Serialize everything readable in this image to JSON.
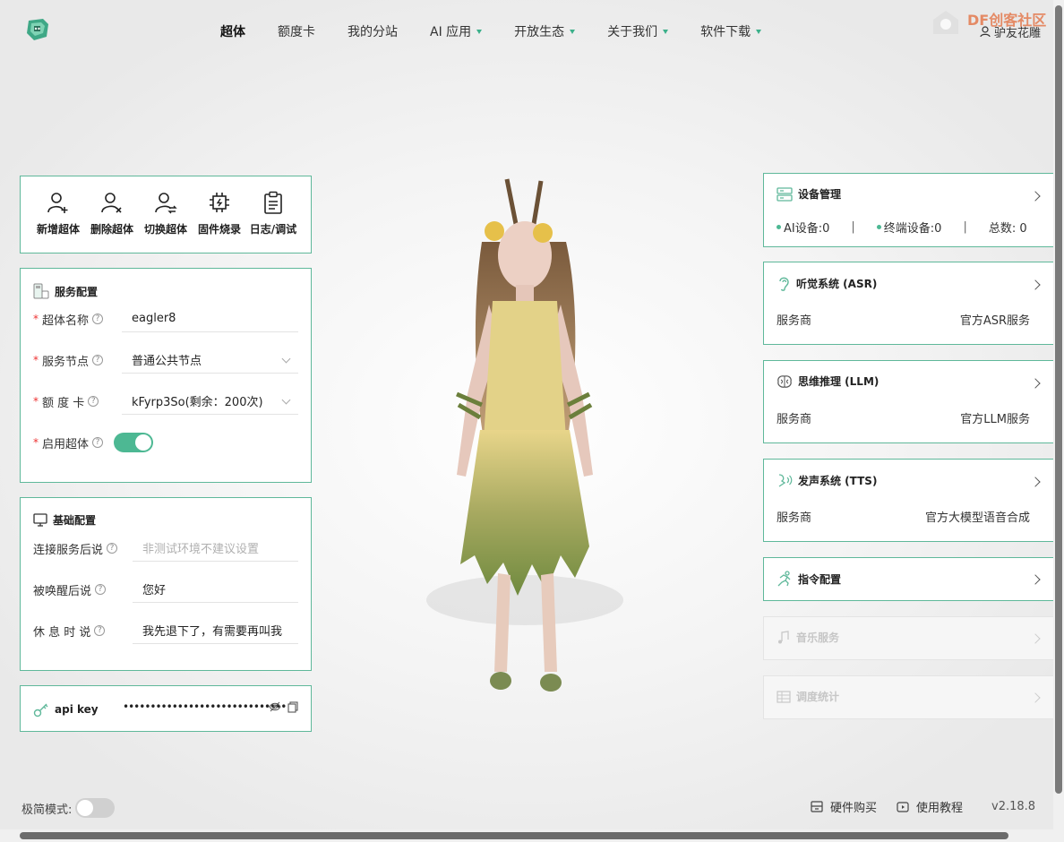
{
  "nav": {
    "items": [
      {
        "label": "超体",
        "active": true,
        "dropdown": false
      },
      {
        "label": "额度卡",
        "dropdown": false
      },
      {
        "label": "我的分站",
        "dropdown": false
      },
      {
        "label": "AI 应用",
        "dropdown": true
      },
      {
        "label": "开放生态",
        "dropdown": true
      },
      {
        "label": "关于我们",
        "dropdown": true
      },
      {
        "label": "软件下载",
        "dropdown": true
      }
    ],
    "user": "驴友花雕",
    "watermark": "DF创客社区"
  },
  "quick_actions": [
    {
      "label": "新增超体",
      "icon": "user-add-icon"
    },
    {
      "label": "删除超体",
      "icon": "user-remove-icon"
    },
    {
      "label": "切换超体",
      "icon": "user-switch-icon"
    },
    {
      "label": "固件烧录",
      "icon": "chip-icon"
    },
    {
      "label": "日志/调试",
      "icon": "clipboard-icon"
    }
  ],
  "service_config": {
    "title": "服务配置",
    "name_label": "超体名称",
    "name_value": "eagler8",
    "node_label": "服务节点",
    "node_value": "普通公共节点",
    "card_label": "额 度 卡",
    "card_value": "kFyrp3So(剩余：200次)",
    "enable_label": "启用超体",
    "enabled": true
  },
  "basic_config": {
    "title": "基础配置",
    "connect_label": "连接服务后说",
    "connect_placeholder": "非测试环境不建议设置",
    "wake_label": "被唤醒后说",
    "wake_value": "您好",
    "rest_label": "休 息 时 说",
    "rest_value": "我先退下了，有需要再叫我"
  },
  "api_key": {
    "label": "api key",
    "masked": "••••••••••••••••••••••••••••••"
  },
  "device": {
    "title": "设备管理",
    "ai_label": "AI设备:0",
    "terminal_label": "终端设备:0",
    "total_label": "总数: 0",
    "separator": "|"
  },
  "asr": {
    "title": "听觉系统 (ASR)",
    "provider_label": "服务商",
    "provider_value": "官方ASR服务"
  },
  "llm": {
    "title": "思维推理 (LLM)",
    "provider_label": "服务商",
    "provider_value": "官方LLM服务"
  },
  "tts": {
    "title": "发声系统 (TTS)",
    "provider_label": "服务商",
    "provider_value": "官方大模型语音合成"
  },
  "command": {
    "title": "指令配置"
  },
  "music": {
    "title": "音乐服务"
  },
  "stats": {
    "title": "调度统计"
  },
  "footer": {
    "minimal_label": "极简模式:",
    "minimal_enabled": false,
    "hardware_label": "硬件购买",
    "tutorial_label": "使用教程",
    "version": "v2.18.8"
  },
  "colors": {
    "accent": "#4db893",
    "border": "#5fb89a",
    "required": "#e33333"
  }
}
